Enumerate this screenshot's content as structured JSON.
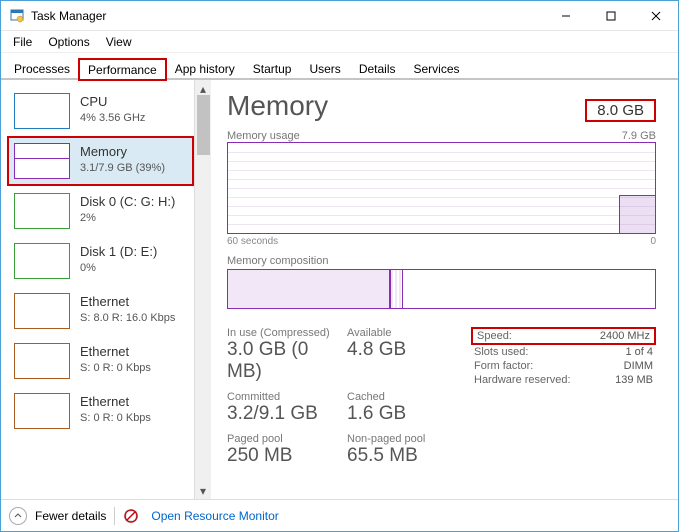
{
  "window": {
    "title": "Task Manager"
  },
  "menu": {
    "file": "File",
    "options": "Options",
    "view": "View"
  },
  "tabs": {
    "processes": "Processes",
    "performance": "Performance",
    "app_history": "App history",
    "startup": "Startup",
    "users": "Users",
    "details": "Details",
    "services": "Services"
  },
  "sidebar": {
    "items": [
      {
        "name": "CPU",
        "sub": "4% 3.56 GHz"
      },
      {
        "name": "Memory",
        "sub": "3.1/7.9 GB (39%)"
      },
      {
        "name": "Disk 0 (C: G: H:)",
        "sub": "2%"
      },
      {
        "name": "Disk 1 (D: E:)",
        "sub": "0%"
      },
      {
        "name": "Ethernet",
        "sub": "S: 8.0 R: 16.0 Kbps"
      },
      {
        "name": "Ethernet",
        "sub": "S: 0 R: 0 Kbps"
      },
      {
        "name": "Ethernet",
        "sub": "S: 0 R: 0 Kbps"
      }
    ]
  },
  "main": {
    "title": "Memory",
    "total": "8.0 GB",
    "usage_label": "Memory usage",
    "usage_max": "7.9 GB",
    "axis_left": "60 seconds",
    "axis_right": "0",
    "comp_label": "Memory composition",
    "stats": {
      "inuse_label": "In use (Compressed)",
      "inuse_value": "3.0 GB (0 MB)",
      "available_label": "Available",
      "available_value": "4.8 GB",
      "committed_label": "Committed",
      "committed_value": "3.2/9.1 GB",
      "cached_label": "Cached",
      "cached_value": "1.6 GB",
      "paged_label": "Paged pool",
      "paged_value": "250 MB",
      "nonpaged_label": "Non-paged pool",
      "nonpaged_value": "65.5 MB"
    },
    "info": {
      "speed_label": "Speed:",
      "speed_value": "2400 MHz",
      "slots_label": "Slots used:",
      "slots_value": "1 of 4",
      "form_label": "Form factor:",
      "form_value": "DIMM",
      "reserved_label": "Hardware reserved:",
      "reserved_value": "139 MB"
    }
  },
  "status": {
    "fewer": "Fewer details",
    "orm": "Open Resource Monitor"
  }
}
